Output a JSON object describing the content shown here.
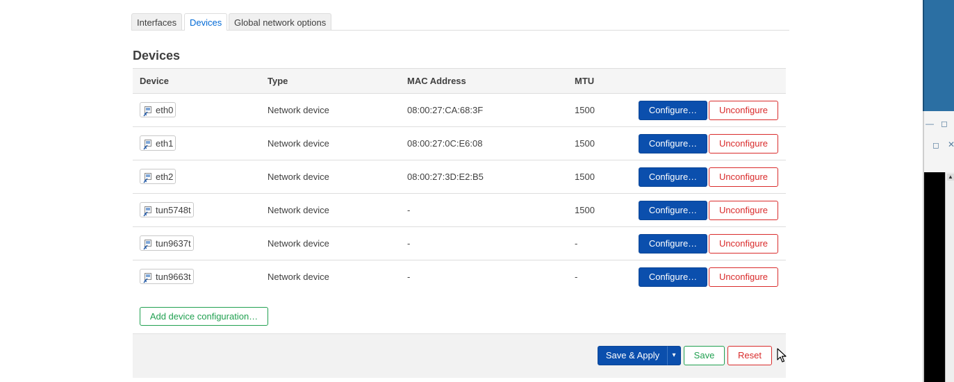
{
  "tabs": [
    {
      "label": "Interfaces",
      "active": false
    },
    {
      "label": "Devices",
      "active": true
    },
    {
      "label": "Global network options",
      "active": false
    }
  ],
  "section": {
    "title": "Devices"
  },
  "table": {
    "headers": {
      "device": "Device",
      "type": "Type",
      "mac": "MAC Address",
      "mtu": "MTU"
    },
    "rows": [
      {
        "device": "eth0",
        "type": "Network device",
        "mac": "08:00:27:CA:68:3F",
        "mtu": "1500"
      },
      {
        "device": "eth1",
        "type": "Network device",
        "mac": "08:00:27:0C:E6:08",
        "mtu": "1500"
      },
      {
        "device": "eth2",
        "type": "Network device",
        "mac": "08:00:27:3D:E2:B5",
        "mtu": "1500"
      },
      {
        "device": "tun5748t",
        "type": "Network device",
        "mac": "-",
        "mtu": "1500"
      },
      {
        "device": "tun9637t",
        "type": "Network device",
        "mac": "-",
        "mtu": "-"
      },
      {
        "device": "tun9663t",
        "type": "Network device",
        "mac": "-",
        "mtu": "-"
      }
    ],
    "configure_label": "Configure…",
    "unconfigure_label": "Unconfigure"
  },
  "add_device_label": "Add device configuration…",
  "actions": {
    "save_apply_label": "Save & Apply",
    "dropdown_glyph": "▾",
    "save_label": "Save",
    "reset_label": "Reset"
  },
  "icons": {
    "device": "network-device-icon",
    "cursor": "mouse-pointer-icon"
  },
  "colors": {
    "primary": "#0b4fad",
    "positive": "#20a050",
    "negative": "#d92b2b",
    "active_tab": "#0069d6"
  }
}
